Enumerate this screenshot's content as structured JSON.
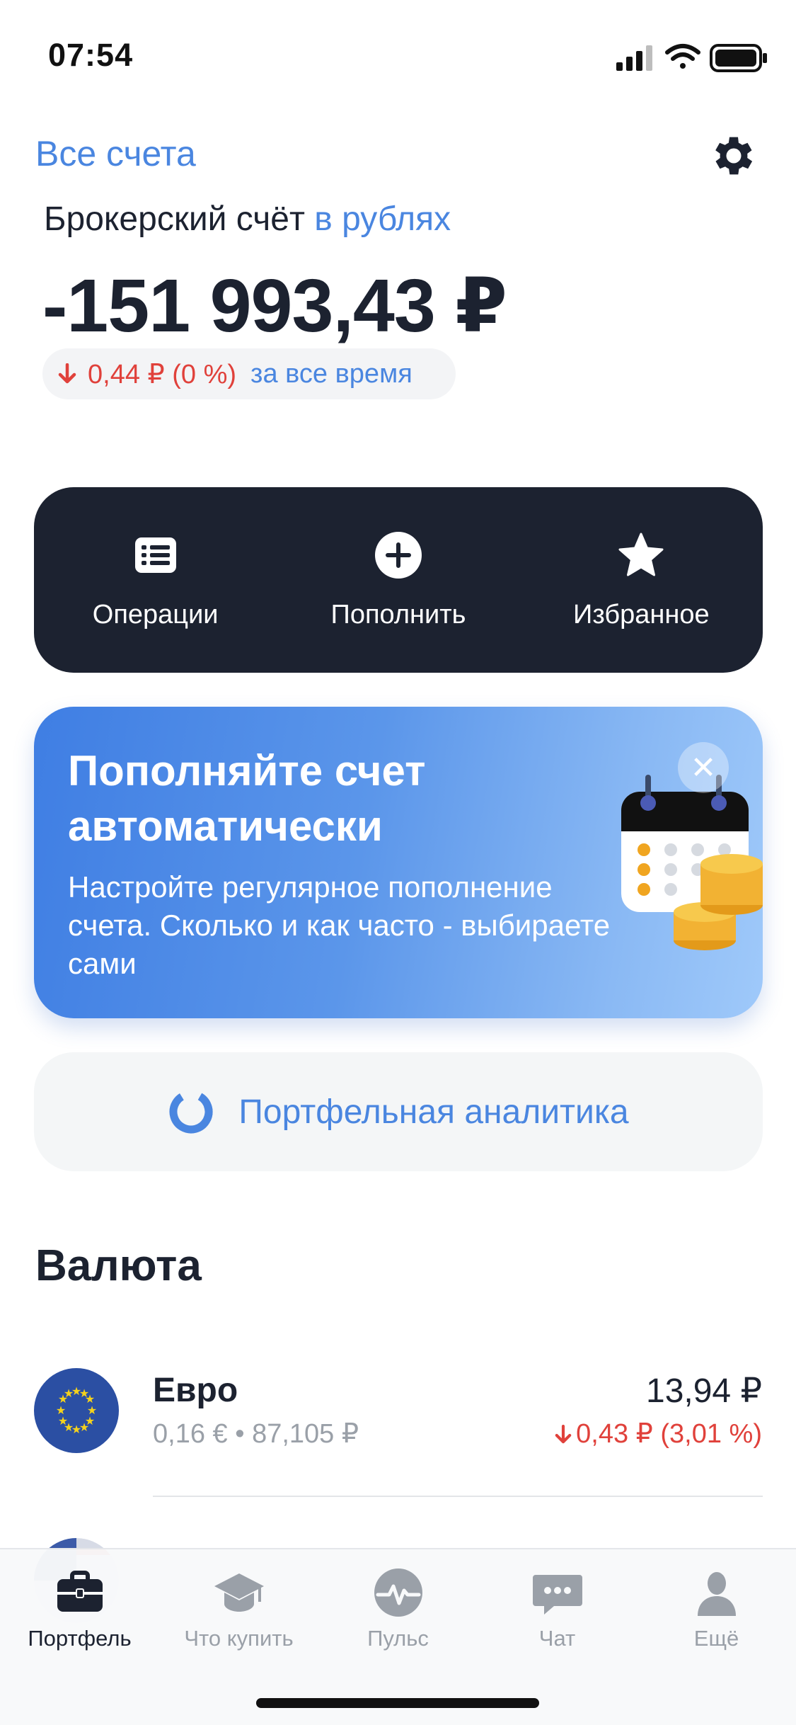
{
  "status_bar": {
    "time": "07:54"
  },
  "header": {
    "all_accounts": "Все счета",
    "account_label": "Брокерский счёт",
    "account_currency": "в рублях",
    "balance": "-151 993,43 ₽",
    "change_value": "0,44 ₽ (0 %)",
    "change_period": "за все время"
  },
  "actions": [
    {
      "label": "Операции",
      "icon": "list-icon"
    },
    {
      "label": "Пополнить",
      "icon": "plus-circle-icon"
    },
    {
      "label": "Избранное",
      "icon": "star-icon"
    }
  ],
  "promo": {
    "title": "Пополняйте счет автоматически",
    "text": "Настройте регулярное пополнение счета. Сколько и как часто - выбираете сами",
    "close_glyph": "✕"
  },
  "analytics": {
    "label": "Портфельная аналитика"
  },
  "currency_section": {
    "title": "Валюта",
    "items": [
      {
        "name": "Евро",
        "amount": "0,16 € • 87,105 ₽",
        "price": "13,94 ₽",
        "delta": "0,43 ₽ (3,01 %)"
      }
    ]
  },
  "tabbar": {
    "items": [
      {
        "label": "Портфель",
        "icon": "briefcase-icon",
        "active": true
      },
      {
        "label": "Что купить",
        "icon": "graduation-cap-icon",
        "active": false
      },
      {
        "label": "Пульс",
        "icon": "pulse-icon",
        "active": false
      },
      {
        "label": "Чат",
        "icon": "chat-icon",
        "active": false
      },
      {
        "label": "Ещё",
        "icon": "profile-icon",
        "active": false
      }
    ]
  },
  "colors": {
    "accent": "#4a86e0",
    "dark": "#1c2230",
    "negative": "#e0413b"
  }
}
